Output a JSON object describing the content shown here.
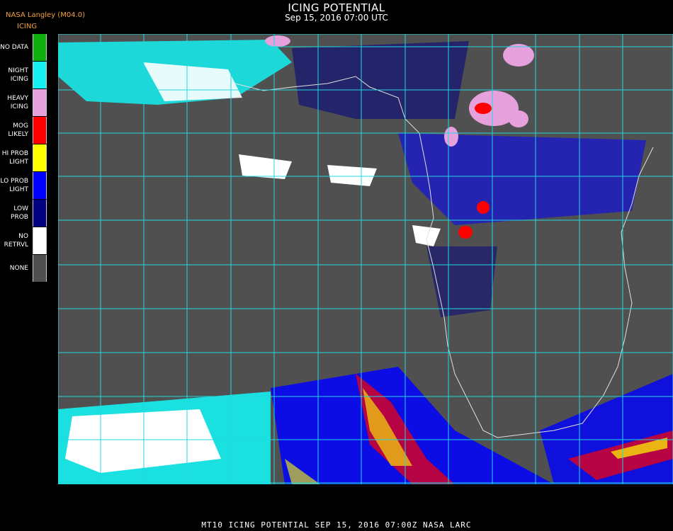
{
  "header": {
    "title": "ICING POTENTIAL",
    "subtitle": "Sep 15, 2016 07:00 UTC",
    "source": "NASA Langley (M04.0)",
    "product": "ICING"
  },
  "legend": [
    {
      "label": "NO DATA",
      "color": "#11b011"
    },
    {
      "label": "NIGHT\nICING",
      "color": "#14f0f0"
    },
    {
      "label": "HEAVY\nICING",
      "color": "#e6a0dc"
    },
    {
      "label": "MOG\nLIKELY",
      "color": "#ff0000"
    },
    {
      "label": "HI PROB\nLIGHT",
      "color": "#ffff00"
    },
    {
      "label": "LO PROB\nLIGHT",
      "color": "#0000ff"
    },
    {
      "label": "LOW\nPROB",
      "color": "#000080"
    },
    {
      "label": "NO\nRETRVL",
      "color": "#ffffff"
    },
    {
      "label": "NONE",
      "color": "#505050"
    }
  ],
  "footer": "MT10  ICING POTENTIAL   SEP 15, 2016 07:00Z   NASA LARC"
}
